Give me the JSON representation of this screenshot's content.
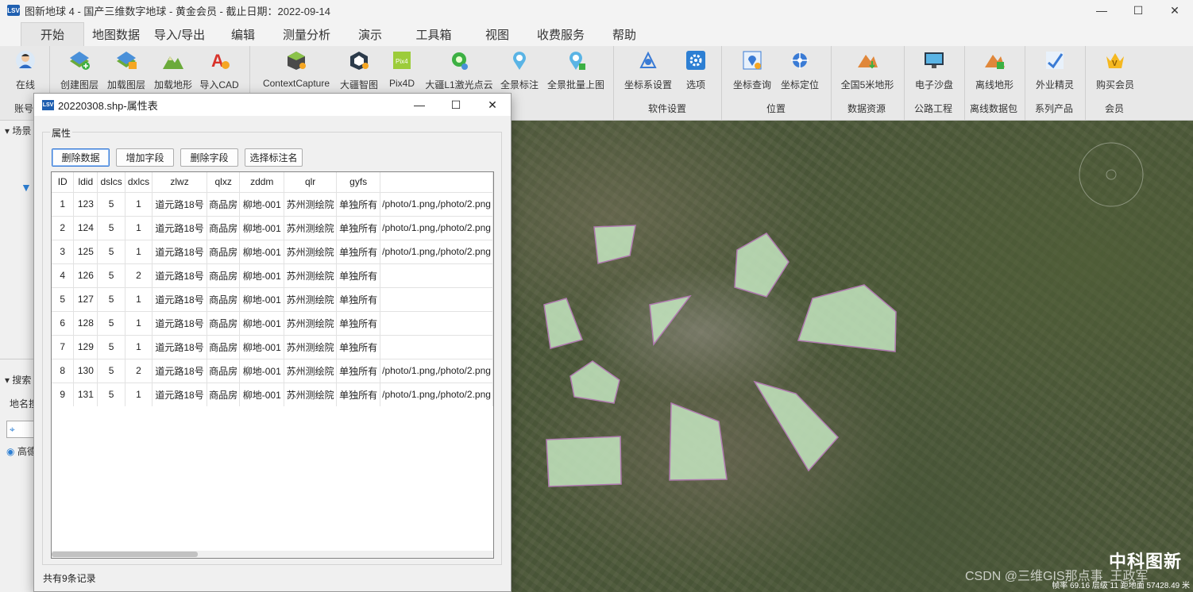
{
  "window": {
    "title": "图新地球 4 - 国产三维数字地球 - 黄金会员 - 截止日期：2022-09-14",
    "logo_text": "LSV"
  },
  "menu": [
    "开始",
    "地图数据",
    "导入/导出",
    "编辑",
    "测量分析",
    "演示",
    "工具箱",
    "视图",
    "收费服务",
    "帮助"
  ],
  "ribbon": {
    "buttons": [
      "在线",
      "创建图层",
      "加载图层",
      "加载地形",
      "导入CAD",
      "ContextCapture",
      "大疆智图",
      "Pix4D",
      "大疆L1激光点云",
      "全景标注",
      "全景批量上图",
      "坐标系设置",
      "选项",
      "坐标查询",
      "坐标定位",
      "全国5米地形",
      "电子沙盘",
      "离线地形",
      "外业精灵",
      "购买会员"
    ],
    "groups": [
      "账号",
      "软件设置",
      "位置",
      "数据资源",
      "公路工程",
      "离线数据包",
      "系列产品",
      "会员"
    ]
  },
  "left_panel": {
    "scene_label": "场景",
    "search_label": "搜索",
    "place_label": "地名搜",
    "radio_label": "高德"
  },
  "dialog": {
    "title": "20220308.shp-属性表",
    "group_label": "属性",
    "buttons": [
      "删除数据",
      "增加字段",
      "删除字段",
      "选择标注名"
    ],
    "columns": [
      "ID",
      "ldid",
      "dslcs",
      "dxlcs",
      "zlwz",
      "qlxz",
      "zddm",
      "qlr",
      "gyfs",
      ""
    ],
    "rows": [
      [
        "1",
        "123",
        "5",
        "1",
        "道元路18号",
        "商品房",
        "柳地-001",
        "苏州测绘院",
        "单独所有",
        "/photo/1.png,/photo/2.png"
      ],
      [
        "2",
        "124",
        "5",
        "1",
        "道元路18号",
        "商品房",
        "柳地-001",
        "苏州测绘院",
        "单独所有",
        "/photo/1.png,/photo/2.png"
      ],
      [
        "3",
        "125",
        "5",
        "1",
        "道元路18号",
        "商品房",
        "柳地-001",
        "苏州测绘院",
        "单独所有",
        "/photo/1.png,/photo/2.png"
      ],
      [
        "4",
        "126",
        "5",
        "2",
        "道元路18号",
        "商品房",
        "柳地-001",
        "苏州测绘院",
        "单独所有",
        ""
      ],
      [
        "5",
        "127",
        "5",
        "1",
        "道元路18号",
        "商品房",
        "柳地-001",
        "苏州测绘院",
        "单独所有",
        ""
      ],
      [
        "6",
        "128",
        "5",
        "1",
        "道元路18号",
        "商品房",
        "柳地-001",
        "苏州测绘院",
        "单独所有",
        ""
      ],
      [
        "7",
        "129",
        "5",
        "1",
        "道元路18号",
        "商品房",
        "柳地-001",
        "苏州测绘院",
        "单独所有",
        ""
      ],
      [
        "8",
        "130",
        "5",
        "2",
        "道元路18号",
        "商品房",
        "柳地-001",
        "苏州测绘院",
        "单独所有",
        "/photo/1.png,/photo/2.png"
      ],
      [
        "9",
        "131",
        "5",
        "1",
        "道元路18号",
        "商品房",
        "柳地-001",
        "苏州测绘院",
        "单独所有",
        "/photo/1.png,/photo/2.png"
      ]
    ],
    "status": "共有9条记录"
  },
  "map": {
    "brand_watermark": "中科图新",
    "csdn_watermark": "CSDN @三维GIS那点事_王政军",
    "status_text": "帧率 69.16  层级 11  距地面 57428.49 米"
  },
  "colors": {
    "accent_blue": "#3a7bd5",
    "polygon_fill": "#c8ecc4",
    "polygon_stroke": "#b07ab0"
  }
}
